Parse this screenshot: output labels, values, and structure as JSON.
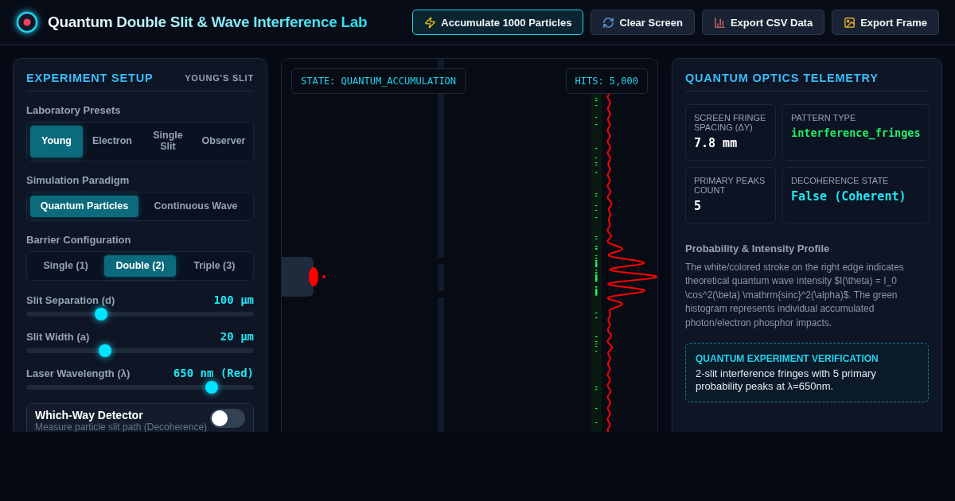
{
  "header": {
    "title_start": "Quantum Double Slit &",
    "title_end": "Wave Interference Lab",
    "actions": [
      {
        "label": "Accumulate 1000 Particles",
        "kind": "zap",
        "primary": true
      },
      {
        "label": "Clear Screen",
        "kind": "refresh",
        "primary": false
      },
      {
        "label": "Export CSV Data",
        "kind": "chart",
        "primary": false
      },
      {
        "label": "Export Frame",
        "kind": "image",
        "primary": false
      }
    ]
  },
  "setup": {
    "title": "EXPERIMENT SETUP",
    "badge": "YOUNG'S SLIT",
    "groups": [
      {
        "label": "Laboratory Presets",
        "options": [
          {
            "label": "Young",
            "selected": true
          },
          {
            "label": "Electron",
            "selected": false
          },
          {
            "label": "Single Slit",
            "selected": false
          },
          {
            "label": "Observer",
            "selected": false
          }
        ]
      },
      {
        "label": "Simulation Paradigm",
        "options": [
          {
            "label": "Quantum Particles",
            "selected": true
          },
          {
            "label": "Continuous Wave",
            "selected": false
          }
        ]
      },
      {
        "label": "Barrier Configuration",
        "options": [
          {
            "label": "Single (1)",
            "selected": false
          },
          {
            "label": "Double (2)",
            "selected": true
          },
          {
            "label": "Triple (3)",
            "selected": false
          }
        ]
      }
    ],
    "sliders": [
      {
        "label": "Slit Separation (d)",
        "reading": "100 µm",
        "level": 0.33
      },
      {
        "label": "Slit Width (a)",
        "reading": "20 µm",
        "level": 0.345
      },
      {
        "label": "Laser Wavelength (λ)",
        "reading": "650 nm (Red)",
        "level": 0.815
      }
    ],
    "detector": {
      "title": "Which-Way Detector",
      "description": "Measure particle slit path (Decoherence)",
      "on": false
    }
  },
  "canvas": {
    "state": "STATE: QUANTUM_ACCUMULATION",
    "hits": "HITS: 5,000"
  },
  "telemetry": {
    "title": "QUANTUM OPTICS TELEMETRY",
    "stats": [
      {
        "label": "SCREEN FRINGE SPACING (ΔY)",
        "value": "7.8 mm",
        "kind": "plain"
      },
      {
        "label": "PATTERN TYPE",
        "value": "interference_fringes",
        "kind": "green"
      },
      {
        "label": "PRIMARY PEAKS COUNT",
        "value": "5",
        "kind": "plain"
      },
      {
        "label": "DECOHERENCE STATE",
        "value": "False (Coherent)",
        "kind": "cyan"
      }
    ],
    "profile_title": "Probability & Intensity Profile",
    "profile_text": "The white/colored stroke on the right edge indicates theoretical quantum wave intensity $I(\\theta) = I_0 \\cos^2(\\beta) \\mathrm{sinc}^2(\\alpha)$. The green histogram represents individual accumulated photon/electron phosphor impacts.",
    "verification": {
      "title": "QUANTUM EXPERIMENT VERIFICATION",
      "text": "2-slit interference fringes with 5 primary probability peaks at λ=650nm."
    }
  }
}
